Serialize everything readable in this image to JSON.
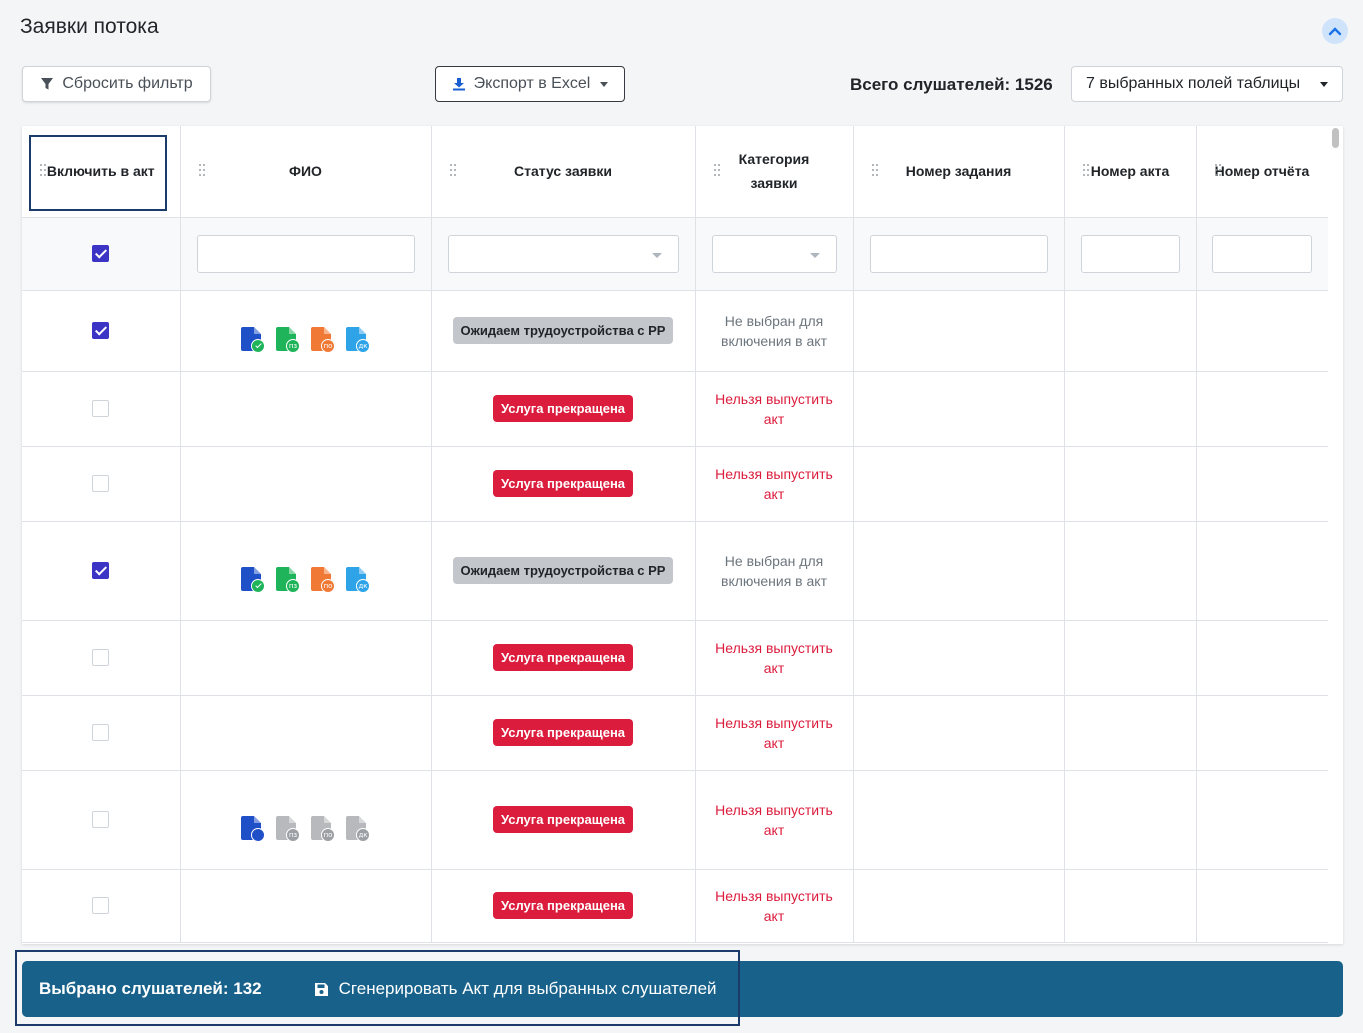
{
  "page": {
    "title": "Заявки потока"
  },
  "toolbar": {
    "reset_label": "Сбросить фильтр",
    "export_label": "Экспорт в Excel",
    "total_label": "Всего слушателей: 1526",
    "fields_label": "7 выбранных полей таблицы"
  },
  "table": {
    "columns": [
      "Включить в акт",
      "ФИО",
      "Статус заявки",
      "Категория заявки",
      "Номер задания",
      "Номер акта",
      "Номер отчёта"
    ],
    "filter_checkbox_checked": true,
    "rows": [
      {
        "checked": true,
        "docs": "full",
        "status": "Ожидаем трудоустройства с РР",
        "status_kind": "grey",
        "category": "Не выбран для включения в акт",
        "category_kind": "grey"
      },
      {
        "checked": false,
        "docs": "",
        "status": "Услуга прекращена",
        "status_kind": "red",
        "category": "Нельзя выпустить акт",
        "category_kind": "red"
      },
      {
        "checked": false,
        "docs": "",
        "status": "Услуга прекращена",
        "status_kind": "red",
        "category": "Нельзя выпустить акт",
        "category_kind": "red"
      },
      {
        "checked": true,
        "docs": "full",
        "status": "Ожидаем трудоустройства с РР",
        "status_kind": "grey",
        "category": "Не выбран для включения в акт",
        "category_kind": "grey"
      },
      {
        "checked": false,
        "docs": "",
        "status": "Услуга прекращена",
        "status_kind": "red",
        "category": "Нельзя выпустить акт",
        "category_kind": "red"
      },
      {
        "checked": false,
        "docs": "",
        "status": "Услуга прекращена",
        "status_kind": "red",
        "category": "Нельзя выпустить акт",
        "category_kind": "red"
      },
      {
        "checked": false,
        "docs": "partial",
        "status": "Услуга прекращена",
        "status_kind": "red",
        "category": "Нельзя выпустить акт",
        "category_kind": "red"
      },
      {
        "checked": false,
        "docs": "",
        "status": "Услуга прекращена",
        "status_kind": "red",
        "category": "Нельзя выпустить акт",
        "category_kind": "red"
      }
    ],
    "doc_badges": [
      "",
      "пз",
      "по",
      "дк"
    ],
    "doc_colors_full": [
      "#2050c8",
      "#1fb45a",
      "#f07a35",
      "#2ea3e8"
    ],
    "doc_dot_colors_full": [
      "#1fb45a",
      "#1fb45a",
      "#f07a35",
      "#2ea3e8"
    ],
    "doc_colors_partial": [
      "#2050c8",
      "#b7b9bc",
      "#b7b9bc",
      "#b7b9bc"
    ],
    "doc_dot_colors_partial": [
      "#2050c8",
      "#9c9fa3",
      "#9c9fa3",
      "#9c9fa3"
    ]
  },
  "footer": {
    "selected_label": "Выбрано слушателей: 132",
    "generate_label": "Сгенерировать Акт для выбранных слушателей"
  }
}
